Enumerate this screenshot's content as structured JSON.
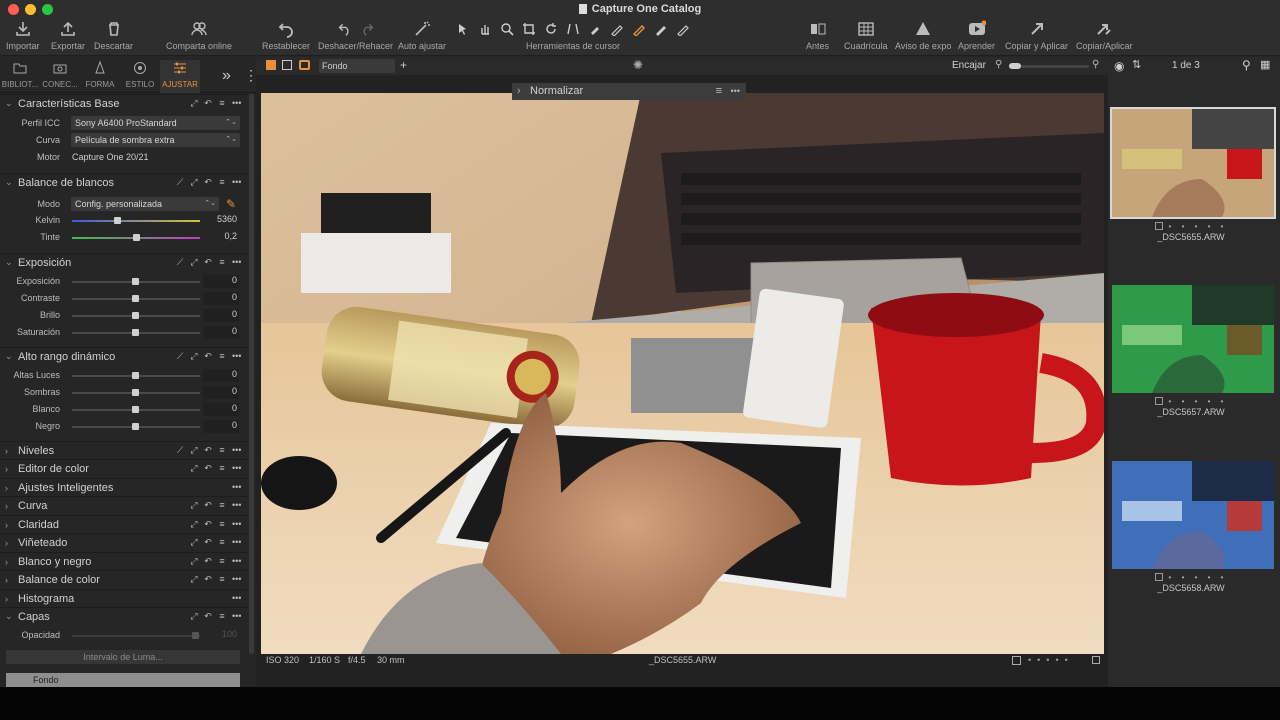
{
  "window": {
    "title": "Capture One Catalog"
  },
  "toolbar": {
    "importar": "Importar",
    "exportar": "Exportar",
    "descartar": "Descartar",
    "compartir": "Comparta online",
    "restablecer": "Restablecer",
    "deshacer": "Deshacer/Rehacer",
    "auto": "Auto ajustar",
    "cursor": "Herramientas de cursor",
    "antes": "Antes",
    "cuadricula": "Cuadrícula",
    "aviso": "Aviso de expo",
    "aprender": "Aprender",
    "copiar_aplicar": "Copiar y Aplicar",
    "copiar_aplicar2": "Copiar/Aplicar"
  },
  "tabs": [
    "BIBLIOT...",
    "CONEC...",
    "FORMA",
    "ESTILO",
    "AJUSTAR"
  ],
  "sections": {
    "base": {
      "title": "Características Base",
      "perfil_label": "Perfil ICC",
      "perfil_value": "Sony A6400 ProStandard",
      "curva_label": "Curva",
      "curva_value": "Película de sombra extra",
      "motor_label": "Motor",
      "motor_value": "Capture One 20/21"
    },
    "wb": {
      "title": "Balance de blancos",
      "modo_label": "Modo",
      "modo_value": "Config. personalizada",
      "kelvin_label": "Kelvin",
      "kelvin_value": "5360",
      "tinte_label": "Tinte",
      "tinte_value": "0,2"
    },
    "exposicion": {
      "title": "Exposición",
      "rows": [
        {
          "label": "Exposición",
          "value": "0"
        },
        {
          "label": "Contraste",
          "value": "0"
        },
        {
          "label": "Brillo",
          "value": "0"
        },
        {
          "label": "Saturación",
          "value": "0"
        }
      ]
    },
    "hdr": {
      "title": "Alto rango dinámico",
      "rows": [
        {
          "label": "Altas Luces",
          "value": "0"
        },
        {
          "label": "Sombras",
          "value": "0"
        },
        {
          "label": "Blanco",
          "value": "0"
        },
        {
          "label": "Negro",
          "value": "0"
        }
      ]
    },
    "collapsed": [
      "Niveles",
      "Editor de color",
      "Ajustes Inteligentes",
      "Curva",
      "Claridad",
      "Viñeteado",
      "Blanco y negro",
      "Balance de color",
      "Histograma"
    ],
    "capas": {
      "title": "Capas",
      "opacidad_label": "Opacidad",
      "opacidad_value": "100",
      "intervalo": "Intervalo de Luma...",
      "fondo": "Fondo"
    }
  },
  "viewer": {
    "layer_select": "Fondo",
    "fit": "Encajar",
    "normalizar": "Normalizar",
    "iso": "ISO 320",
    "shutter": "1/160 S",
    "aperture": "f/4.5",
    "focal": "30 mm",
    "filename": "_DSC5655.ARW"
  },
  "browser": {
    "counter": "1 de 3",
    "thumbs": [
      {
        "name": "_DSC5655.ARW",
        "tint": "#c7a57a",
        "rating": "• • • • •"
      },
      {
        "name": "_DSC5657.ARW",
        "tint": "#2f9a4a",
        "rating": "• • • • •"
      },
      {
        "name": "_DSC5658.ARW",
        "tint": "#3f6fb8",
        "rating": "• • • • •"
      }
    ]
  },
  "colors": {
    "accent": "#e8913a",
    "panel": "#262626"
  }
}
